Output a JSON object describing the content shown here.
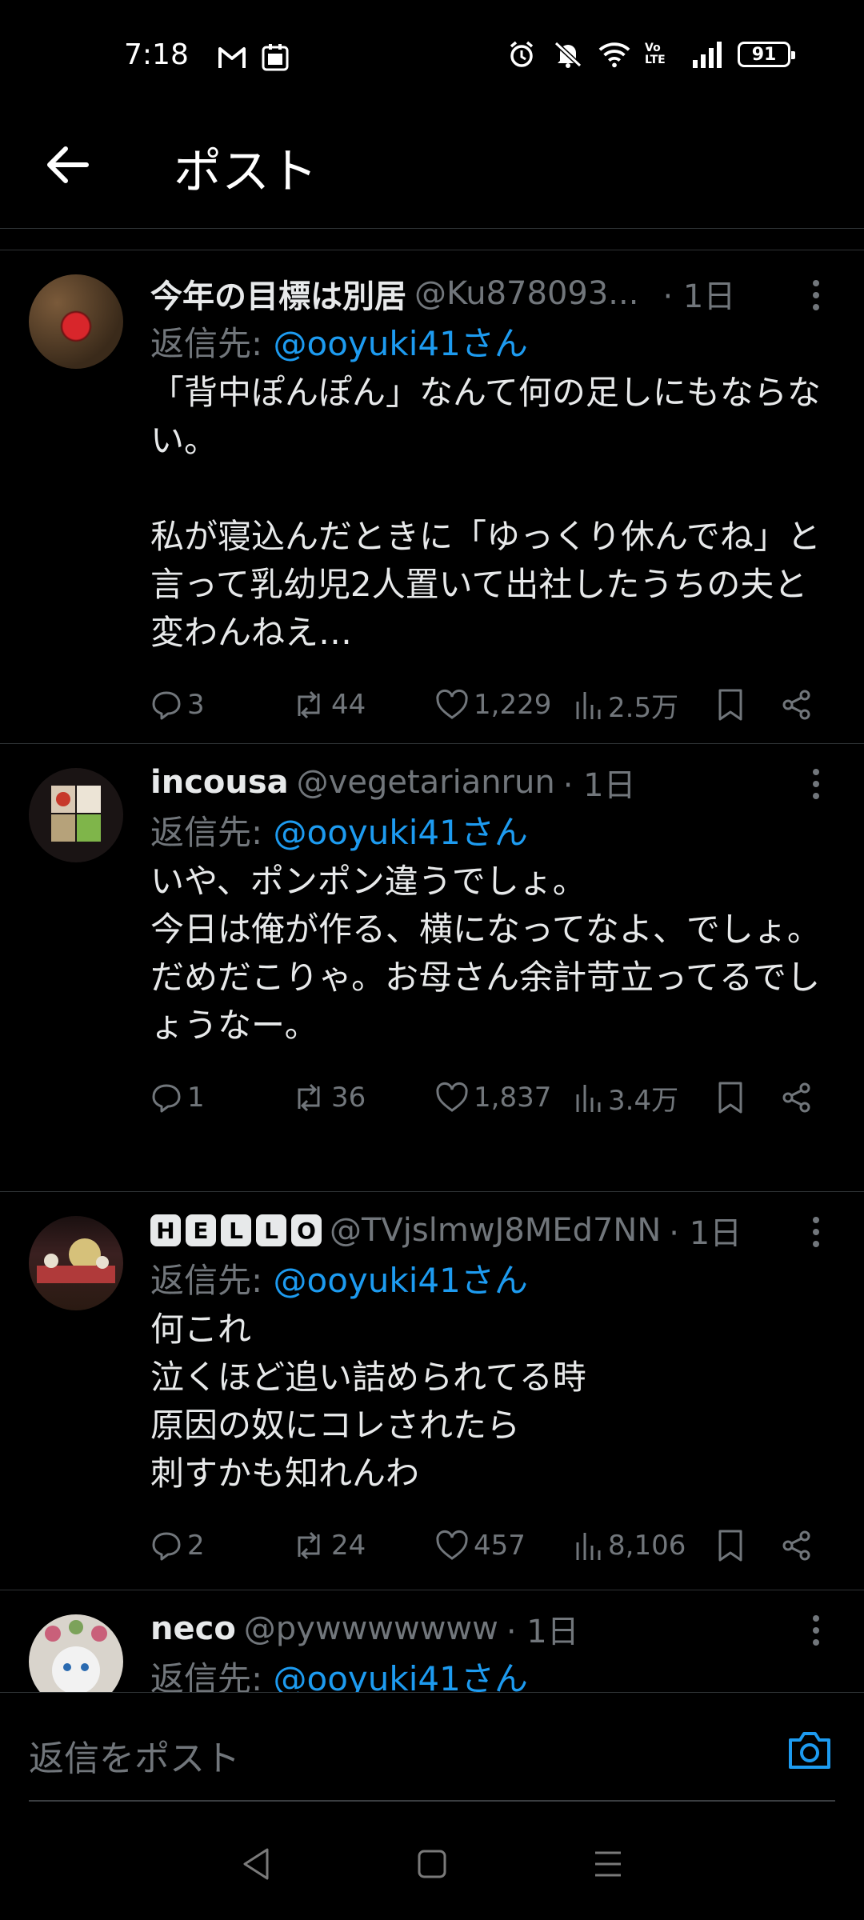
{
  "status": {
    "time": "7:18",
    "battery": "91",
    "volte": "Vo LTE"
  },
  "header": {
    "title": "ポスト",
    "back_icon": "arrow-left-icon"
  },
  "colors": {
    "background": "#000000",
    "text": "#e7e9ea",
    "muted": "#71767b",
    "accent": "#1d9bf0",
    "divider": "#2f3336"
  },
  "posts": [
    {
      "name": "今年の目標は別居",
      "handle": "@Ku878093...",
      "time": "· 1日",
      "reply_prefix": "返信先: ",
      "reply_to": "@ooyuki41さん",
      "body": "「背中ぽんぽん」なんて何の足しにもならない。\n\n私が寝込んだときに「ゆっくり休んでね」と言って乳幼児2人置いて出社したうちの夫と変わんねえ…",
      "replies": "3",
      "reposts": "44",
      "likes": "1,229",
      "views": "2.5万"
    },
    {
      "name": "incousa",
      "handle": "@vegetarianrun",
      "time": "· 1日",
      "reply_prefix": "返信先: ",
      "reply_to": "@ooyuki41さん",
      "body": "いや、ポンポン違うでしょ。\n今日は俺が作る、横になってなよ、でしょ。\nだめだこりゃ。お母さん余計苛立ってるでしょうなー。",
      "replies": "1",
      "reposts": "36",
      "likes": "1,837",
      "views": "3.4万"
    },
    {
      "name_badges": [
        "H",
        "E",
        "L",
        "L",
        "O"
      ],
      "handle": "@TVjslmwJ8MEd7NN",
      "time": "· 1日",
      "reply_prefix": "返信先: ",
      "reply_to": "@ooyuki41さん",
      "body": "何これ\n泣くほど追い詰められてる時\n原因の奴にコレされたら\n刺すかも知れんわ",
      "replies": "2",
      "reposts": "24",
      "likes": "457",
      "views": "8,106"
    },
    {
      "name": "neco",
      "handle": "@pywwwwwww",
      "time": "· 1日",
      "reply_prefix": "返信先: ",
      "reply_to": "@ooyuki41さん"
    }
  ],
  "reply_bar": {
    "placeholder": "返信をポスト",
    "camera_icon": "camera-icon"
  },
  "navbar": {
    "back": "triangle-back-icon",
    "home": "square-home-icon",
    "menu": "menu-lines-icon"
  }
}
